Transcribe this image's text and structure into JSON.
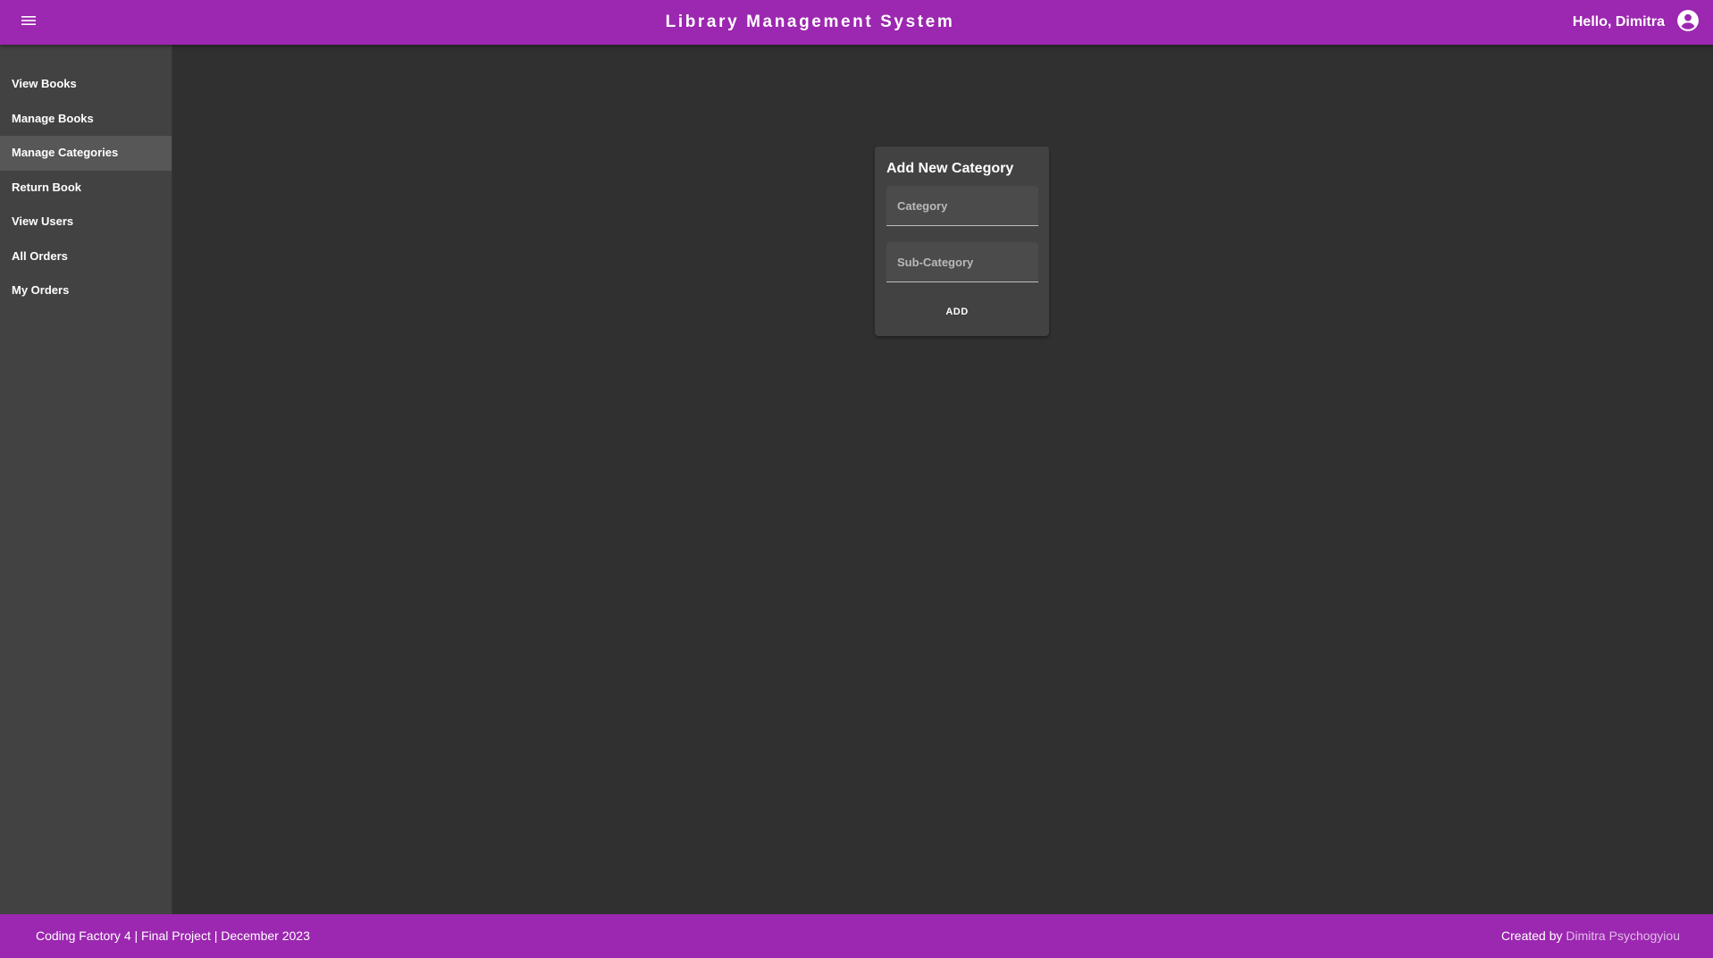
{
  "header": {
    "title": "Library Management System",
    "greeting": "Hello, Dimitra",
    "menu_icon": "menu-icon",
    "account_icon": "account-circle-icon"
  },
  "sidebar": {
    "items": [
      {
        "label": "View Books"
      },
      {
        "label": "Manage Books"
      },
      {
        "label": "Manage Categories",
        "active": true
      },
      {
        "label": "Return Book"
      },
      {
        "label": "View Users"
      },
      {
        "label": "All Orders"
      },
      {
        "label": "My Orders"
      }
    ]
  },
  "form": {
    "title": "Add New Category",
    "category": {
      "placeholder": "Category",
      "value": ""
    },
    "sub_category": {
      "placeholder": "Sub-Category",
      "value": ""
    },
    "add_label": "ADD"
  },
  "footer": {
    "left_text": "Coding Factory 4 | Final Project | December 2023",
    "created_by": "Created by",
    "author": "Dimitra Psychogyiou"
  },
  "colors": {
    "primary": "#9c27b0",
    "background": "#303030",
    "surface": "#424242",
    "link": "#e1bee7"
  }
}
